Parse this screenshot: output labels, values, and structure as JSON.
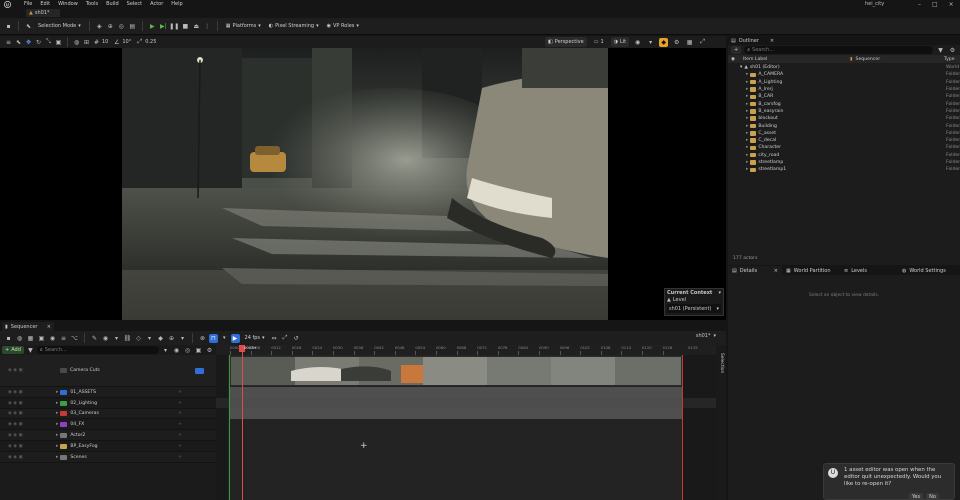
{
  "app": {
    "project_name": "hei_city"
  },
  "menu": [
    "File",
    "Edit",
    "Window",
    "Tools",
    "Build",
    "Select",
    "Actor",
    "Help"
  ],
  "level_tab": "sh01*",
  "toolbar": {
    "selection_mode": "Selection Mode",
    "platforms": "Platforms",
    "pixel_streaming": "Pixel Streaming",
    "vp_roles": "VP Roles"
  },
  "viewport": {
    "snap_values": [
      "10",
      "10°",
      "0.25"
    ],
    "view_mode": "Perspective",
    "lit": "Lit",
    "cinematic_num": "1",
    "context": {
      "title": "Current Context",
      "level_label": "Level",
      "level_value": "sh01 (Persistent)"
    }
  },
  "outliner": {
    "tab": "Outliner",
    "search_placeholder": "Search...",
    "col_label": "Item Label",
    "col_sequencer": "Sequencer",
    "col_type": "Type",
    "root": {
      "label": "sh01 (Editor)",
      "type": "World"
    },
    "items": [
      {
        "label": "A_CAMERA",
        "type": "Folder"
      },
      {
        "label": "A_Lighting",
        "type": "Folder"
      },
      {
        "label": "A_lrerj",
        "type": "Folder"
      },
      {
        "label": "B_CAR",
        "type": "Folder"
      },
      {
        "label": "B_carsfog",
        "type": "Folder"
      },
      {
        "label": "B_easyrain",
        "type": "Folder"
      },
      {
        "label": "blockout",
        "type": "Folder"
      },
      {
        "label": "Building",
        "type": "Folder"
      },
      {
        "label": "C_asset",
        "type": "Folder"
      },
      {
        "label": "C_decal",
        "type": "Folder"
      },
      {
        "label": "Character",
        "type": "Folder"
      },
      {
        "label": "city_road",
        "type": "Folder"
      },
      {
        "label": "streetlamp",
        "type": "Folder"
      },
      {
        "label": "streetlamp1",
        "type": "Folder"
      }
    ],
    "actor_count": "177 actors"
  },
  "details": {
    "tabs": [
      "Details",
      "World Partition",
      "Levels",
      "World Settings"
    ],
    "empty_text": "Select an object to view details."
  },
  "sequencer": {
    "tab": "Sequencer",
    "add_label": "Add",
    "search_placeholder": "Search...",
    "fps": "24 fps",
    "track_count": "1",
    "playhead_frame": "0003+",
    "end_frame": "0135",
    "ruler_ticks": [
      "0000",
      "0006",
      "0012",
      "0018",
      "0024",
      "0030",
      "0036",
      "0042",
      "0048",
      "0054",
      "0060",
      "0066",
      "0072",
      "0078",
      "0084",
      "0090",
      "0096",
      "0102",
      "0108",
      "0114",
      "0120",
      "0126"
    ],
    "tracks": [
      {
        "label": "Camera Cuts",
        "color": "#4a4a4a"
      },
      {
        "label": "01_ASSETS",
        "color": "#2e6fd6"
      },
      {
        "label": "02_Lighting",
        "color": "#3f9f3f"
      },
      {
        "label": "03_Cameras",
        "color": "#c83a3a"
      },
      {
        "label": "04_FX",
        "color": "#8f3fc8"
      },
      {
        "label": "Actor2",
        "color": "#777777"
      },
      {
        "label": "BP_EasyFog",
        "color": "#c9a24e"
      },
      {
        "label": "Scenes",
        "color": "#777777"
      }
    ],
    "selection_label": "Selection"
  },
  "notification": {
    "text": "1 asset editor was open when the editor quit unexpectedly. Would you like to re-open it?",
    "yes": "Yes",
    "no": "No"
  }
}
